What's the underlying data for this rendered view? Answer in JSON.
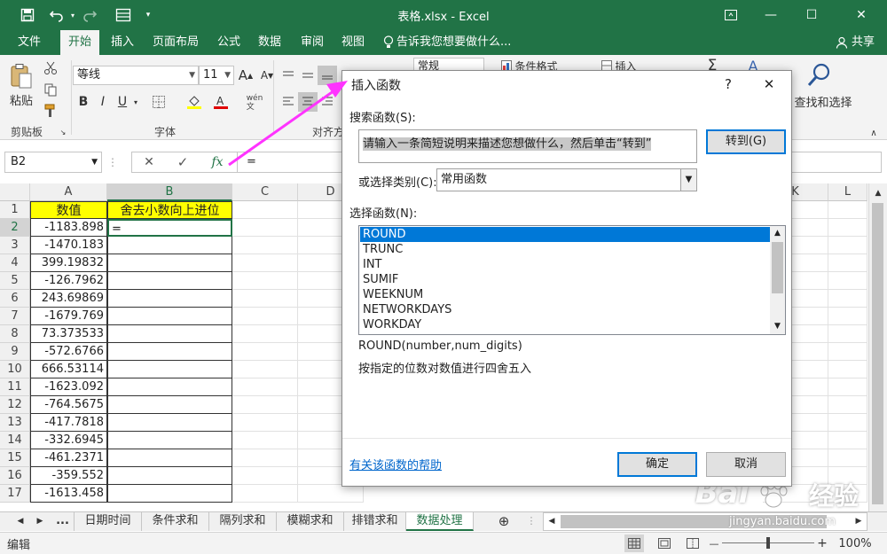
{
  "window": {
    "title": "表格.xlsx - Excel",
    "minimize": "—",
    "maximize": "☐",
    "close": "✕",
    "restore": "▭"
  },
  "tabs": [
    {
      "label": "文件"
    },
    {
      "label": "开始"
    },
    {
      "label": "插入"
    },
    {
      "label": "页面布局"
    },
    {
      "label": "公式"
    },
    {
      "label": "数据"
    },
    {
      "label": "审阅"
    },
    {
      "label": "视图"
    }
  ],
  "tell_me": "告诉我您想要做什么...",
  "share": "共享",
  "ribbon": {
    "paste": "粘贴",
    "clipboard_group": "剪贴板",
    "font_name": "等线",
    "font_size": "11",
    "font_group": "字体",
    "bold": "B",
    "italic": "I",
    "underline": "U",
    "wen": "wén\n文",
    "align_group": "对齐方",
    "number_format": "常规",
    "cond_format": "条件格式",
    "insert": "插入",
    "sigma": "Σ",
    "find_select": "查找和选择"
  },
  "formula_bar": {
    "name_box": "B2",
    "cancel": "✕",
    "enter": "✓",
    "fx": "fx",
    "content": "="
  },
  "grid": {
    "columns": [
      "A",
      "B",
      "C",
      "D",
      "K",
      "L"
    ],
    "rows": [
      "1",
      "2",
      "3",
      "4",
      "5",
      "6",
      "7",
      "8",
      "9",
      "10",
      "11",
      "12",
      "13",
      "14",
      "15",
      "16",
      "17"
    ],
    "header_a": "数值",
    "header_b": "舍去小数向上进位",
    "active_value": "=",
    "values": [
      "-1183.898",
      "-1470.183",
      "399.19832",
      "-126.7962",
      "243.69869",
      "-1679.769",
      "73.373533",
      "-572.6766",
      "666.53114",
      "-1623.092",
      "-764.5675",
      "-417.7818",
      "-332.6945",
      "-461.2371",
      "-359.552",
      "-1613.458"
    ]
  },
  "sheets": {
    "nav_prev": "◀",
    "nav_next": "▶",
    "more": "...",
    "tabs": [
      "日期时间",
      "条件求和",
      "隔列求和",
      "模糊求和",
      "排错求和",
      "数据处理"
    ],
    "add": "⊕"
  },
  "status": {
    "mode": "编辑",
    "zoom": "100%",
    "minus": "—",
    "plus": "+"
  },
  "dialog": {
    "title": "插入函数",
    "help_btn": "?",
    "close_btn": "✕",
    "search_label": "搜索函数(S):",
    "search_text": "请输入一条简短说明来描述您想做什么，然后单击“转到”",
    "go_btn": "转到(G)",
    "category_label": "或选择类别(C):",
    "category_value": "常用函数",
    "select_label": "选择函数(N):",
    "functions": [
      "ROUND",
      "TRUNC",
      "INT",
      "SUMIF",
      "WEEKNUM",
      "NETWORKDAYS",
      "WORKDAY"
    ],
    "signature": "ROUND(number,num_digits)",
    "description": "按指定的位数对数值进行四舍五入",
    "help_link": "有关该函数的帮助",
    "ok_btn": "确定",
    "cancel_btn": "取消"
  },
  "watermark": {
    "brand": "Bai",
    "brand2": "经验",
    "url": "jingyan.baidu.com"
  },
  "colors": {
    "excel_green": "#217346",
    "header_yellow": "#ffff00",
    "selection_blue": "#0078d7",
    "arrow_magenta": "#ff33ff"
  }
}
